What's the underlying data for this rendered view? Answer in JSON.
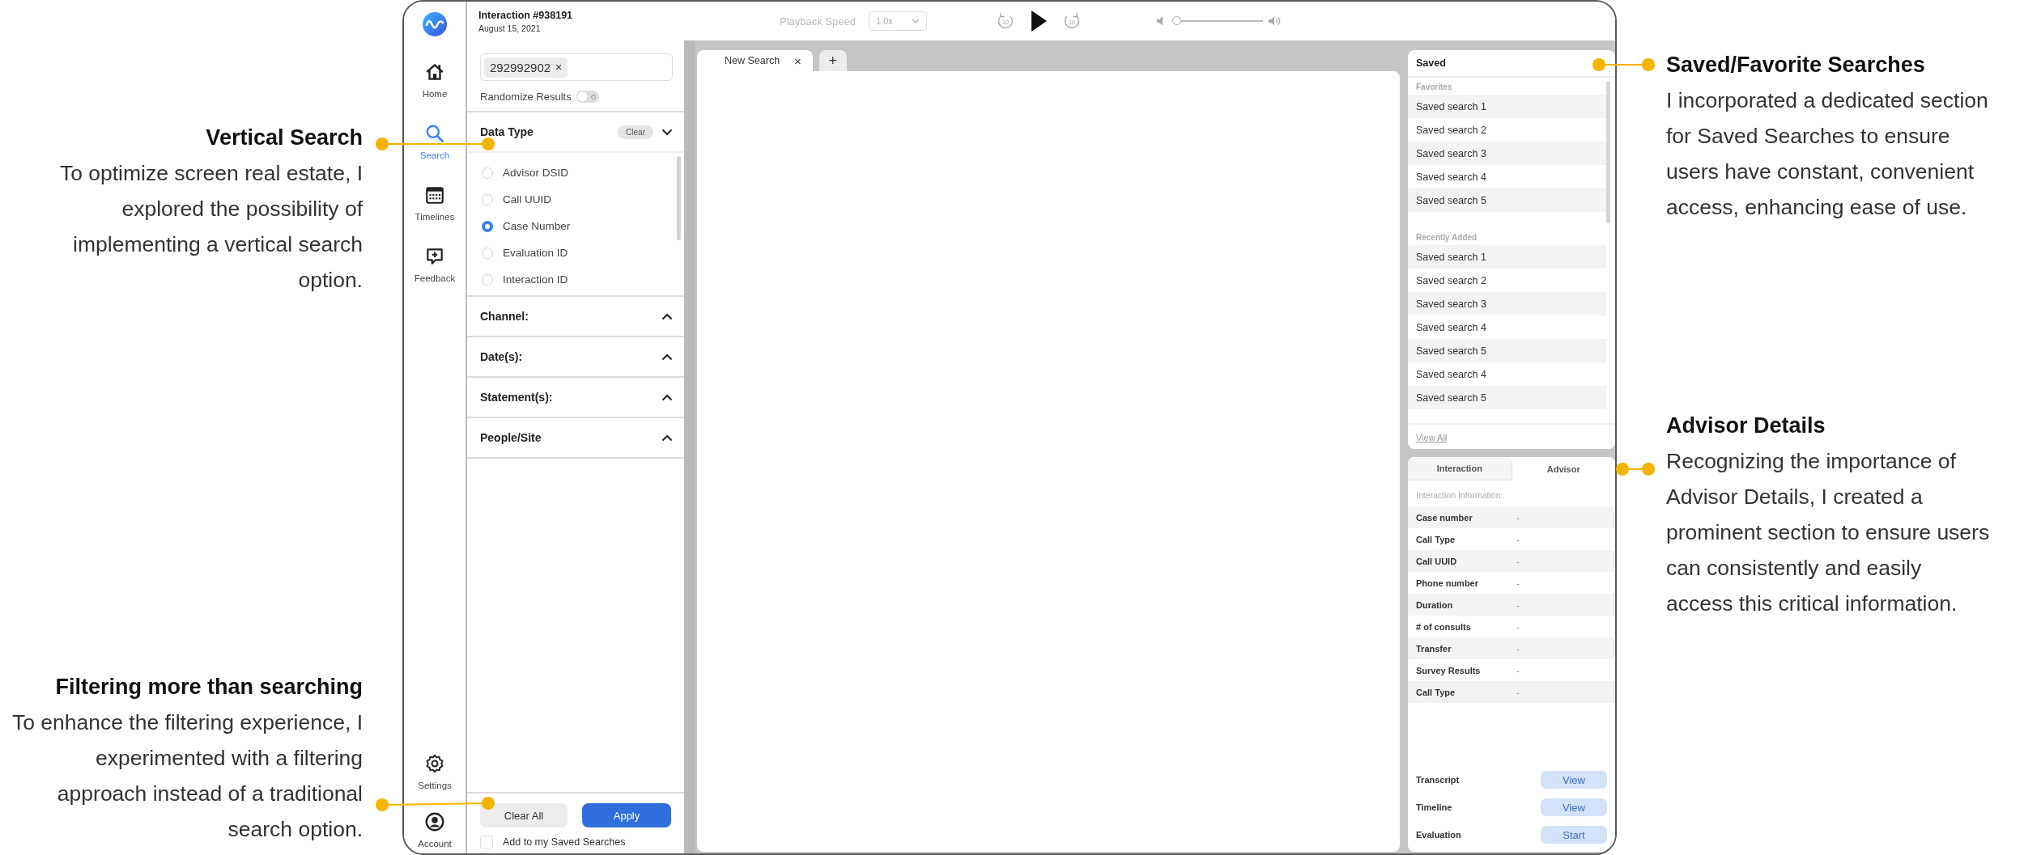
{
  "annotations_left": [
    {
      "title": "Vertical Search",
      "text": "To optimize screen real estate, I explored the possibility of implementing a vertical search option."
    },
    {
      "title": "Filtering more than searching",
      "text": "To enhance the filtering experience, I experimented with a filtering approach instead of a traditional search option."
    }
  ],
  "annotations_right": [
    {
      "title": "Saved/Favorite Searches",
      "text": "I incorporated a dedicated section for Saved Searches to ensure users have constant, convenient access, enhancing ease of use."
    },
    {
      "title": "Advisor Details",
      "text": "Recognizing the importance of Advisor Details, I created a prominent section to ensure users can consistently and easily access this critical information."
    }
  ],
  "nav": {
    "items": [
      {
        "kind": "home",
        "label": "Home",
        "selected": false
      },
      {
        "kind": "search",
        "label": "Search",
        "selected": true
      },
      {
        "kind": "timelines",
        "label": "Timelines",
        "selected": false
      },
      {
        "kind": "feedback",
        "label": "Feedback",
        "selected": false
      }
    ],
    "bottom_items": [
      {
        "kind": "settings",
        "label": "Settings",
        "selected": false
      },
      {
        "kind": "account",
        "label": "Account",
        "selected": false
      }
    ]
  },
  "top_bar": {
    "title": "Interaction #938191",
    "date": "August 15, 2021",
    "playback_label": "Playback Speed",
    "playback_speed": "1.0x",
    "rewind": "10",
    "forward": "10",
    "volume": {
      "level": 0
    }
  },
  "filter": {
    "chip": "292992902",
    "chip_remove": "×",
    "randomize": {
      "label": "Randomize Results",
      "on": false
    },
    "sections": [
      {
        "title": "Data Type",
        "expanded": true,
        "clear": "Clear",
        "options": [
          {
            "label": "Advisor DSID",
            "selected": false
          },
          {
            "label": "Call UUID",
            "selected": false
          },
          {
            "label": "Case Number",
            "selected": true
          },
          {
            "label": "Evaluation ID",
            "selected": false
          },
          {
            "label": "Interaction ID",
            "selected": false
          }
        ]
      },
      {
        "title": "Channel:",
        "expanded": false
      },
      {
        "title": "Date(s):",
        "expanded": false
      },
      {
        "title": "Statement(s):",
        "expanded": false
      },
      {
        "title": "People/Site",
        "expanded": false
      }
    ],
    "clear_all": "Clear All",
    "apply": "Apply",
    "save_option": {
      "label": "Add to my Saved Searches",
      "checked": false
    }
  },
  "workspace": {
    "tabs": [
      {
        "label": "New Search",
        "close": "×",
        "selected": true
      }
    ],
    "add_tab": "+"
  },
  "saved": {
    "title": "Saved",
    "groups": [
      {
        "heading": "Favorites",
        "items": [
          "Saved search 1",
          "Saved search 2",
          "Saved search 3",
          "Saved search 4",
          "Saved search 5"
        ]
      },
      {
        "heading": "Recently Added",
        "items": [
          "Saved search 1",
          "Saved search 2",
          "Saved search 3",
          "Saved search 4",
          "Saved search 5",
          "Saved search 4",
          "Saved search 5"
        ]
      }
    ],
    "view_all": "View All"
  },
  "details": {
    "tabs": [
      {
        "label": "Interaction",
        "selected": false
      },
      {
        "label": "Advisor",
        "selected": true
      }
    ],
    "heading": "Interaction Information:",
    "rows": [
      {
        "label": "Case number",
        "value": "-"
      },
      {
        "label": "Call Type",
        "value": "-"
      },
      {
        "label": "Call UUID",
        "value": "-"
      },
      {
        "label": "Phone number",
        "value": "-"
      },
      {
        "label": "Duration",
        "value": "-"
      },
      {
        "label": "# of consults",
        "value": "-"
      },
      {
        "label": "Transfer",
        "value": "-"
      },
      {
        "label": "Survey Results",
        "value": "-"
      },
      {
        "label": "Call Type",
        "value": "-"
      }
    ],
    "actions": [
      {
        "label": "Transcript",
        "button": "View",
        "disabled": true
      },
      {
        "label": "Timeline",
        "button": "View",
        "disabled": true
      },
      {
        "label": "Evaluation",
        "button": "Start",
        "disabled": true
      }
    ]
  }
}
